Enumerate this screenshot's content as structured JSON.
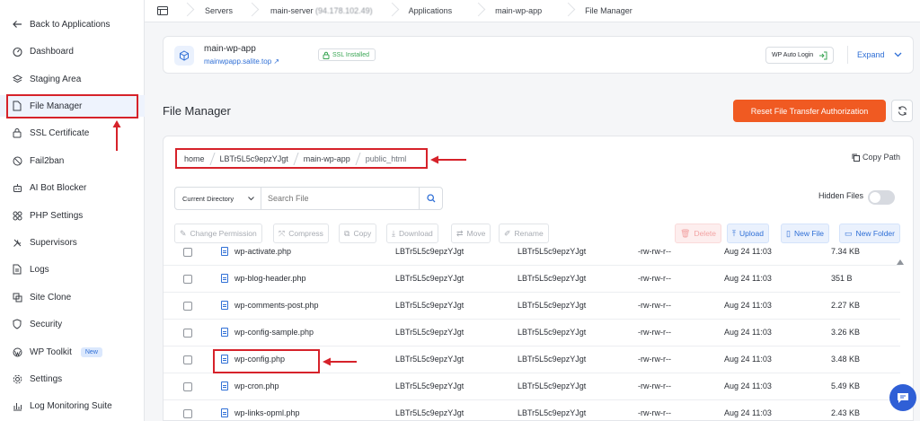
{
  "sidebar": {
    "back": "Back to Applications",
    "items": [
      {
        "label": "Dashboard",
        "icon": "dashboard-icon"
      },
      {
        "label": "Staging Area",
        "icon": "staging-icon"
      },
      {
        "label": "File Manager",
        "icon": "file-icon"
      },
      {
        "label": "SSL Certificate",
        "icon": "lock-icon"
      },
      {
        "label": "Fail2ban",
        "icon": "ban-icon"
      },
      {
        "label": "AI Bot Blocker",
        "icon": "robot-icon"
      },
      {
        "label": "PHP Settings",
        "icon": "settings-icon"
      },
      {
        "label": "Supervisors",
        "icon": "tools-icon"
      },
      {
        "label": "Logs",
        "icon": "logs-icon"
      },
      {
        "label": "Site Clone",
        "icon": "clone-icon"
      },
      {
        "label": "Security",
        "icon": "shield-icon"
      },
      {
        "label": "WP Toolkit",
        "icon": "wordpress-icon",
        "badge": "New"
      },
      {
        "label": "Settings",
        "icon": "gear-icon"
      },
      {
        "label": "Log Monitoring Suite",
        "icon": "monitor-icon"
      }
    ]
  },
  "breadcrumb": {
    "servers": "Servers",
    "server": "main-server",
    "server_ip": "(94.178.102.49)",
    "applications": "Applications",
    "app": "main-wp-app",
    "page": "File Manager"
  },
  "app": {
    "name": "main-wp-app",
    "url": "mainwpapp.salite.top",
    "ssl": "SSL Installed",
    "autologin": "WP Auto Login",
    "expand": "Expand"
  },
  "title": "File Manager",
  "reset_label": "Reset File Transfer Authorization",
  "path": {
    "segments": [
      "home",
      "LBTr5L5c9epzYJgt",
      "main-wp-app",
      "public_html"
    ],
    "copy_label": "Copy Path"
  },
  "search": {
    "scope": "Current Directory",
    "placeholder": "Search File",
    "hidden_files": "Hidden Files"
  },
  "toolbar": {
    "change_permission": "Change Permission",
    "compress": "Compress",
    "copy": "Copy",
    "download": "Download",
    "move": "Move",
    "rename": "Rename",
    "delete": "Delete",
    "upload": "Upload",
    "new_file": "New File",
    "new_folder": "New Folder"
  },
  "files": [
    {
      "name": "wp-activate.php",
      "owner": "LBTr5L5c9epzYJgt",
      "group": "LBTr5L5c9epzYJgt",
      "perm": "-rw-rw-r--",
      "date": "Aug 24 11:03",
      "size": "7.34 KB"
    },
    {
      "name": "wp-blog-header.php",
      "owner": "LBTr5L5c9epzYJgt",
      "group": "LBTr5L5c9epzYJgt",
      "perm": "-rw-rw-r--",
      "date": "Aug 24 11:03",
      "size": "351 B"
    },
    {
      "name": "wp-comments-post.php",
      "owner": "LBTr5L5c9epzYJgt",
      "group": "LBTr5L5c9epzYJgt",
      "perm": "-rw-rw-r--",
      "date": "Aug 24 11:03",
      "size": "2.27 KB"
    },
    {
      "name": "wp-config-sample.php",
      "owner": "LBTr5L5c9epzYJgt",
      "group": "LBTr5L5c9epzYJgt",
      "perm": "-rw-rw-r--",
      "date": "Aug 24 11:03",
      "size": "3.26 KB"
    },
    {
      "name": "wp-config.php",
      "owner": "LBTr5L5c9epzYJgt",
      "group": "LBTr5L5c9epzYJgt",
      "perm": "-rw-rw-r--",
      "date": "Aug 24 11:03",
      "size": "3.48 KB"
    },
    {
      "name": "wp-cron.php",
      "owner": "LBTr5L5c9epzYJgt",
      "group": "LBTr5L5c9epzYJgt",
      "perm": "-rw-rw-r--",
      "date": "Aug 24 11:03",
      "size": "5.49 KB"
    },
    {
      "name": "wp-links-opml.php",
      "owner": "LBTr5L5c9epzYJgt",
      "group": "LBTr5L5c9epzYJgt",
      "perm": "-rw-rw-r--",
      "date": "Aug 24 11:03",
      "size": "2.43 KB"
    }
  ],
  "colors": {
    "accent": "#f05a22",
    "link": "#2f6fd6",
    "highlight": "#d6222a"
  }
}
